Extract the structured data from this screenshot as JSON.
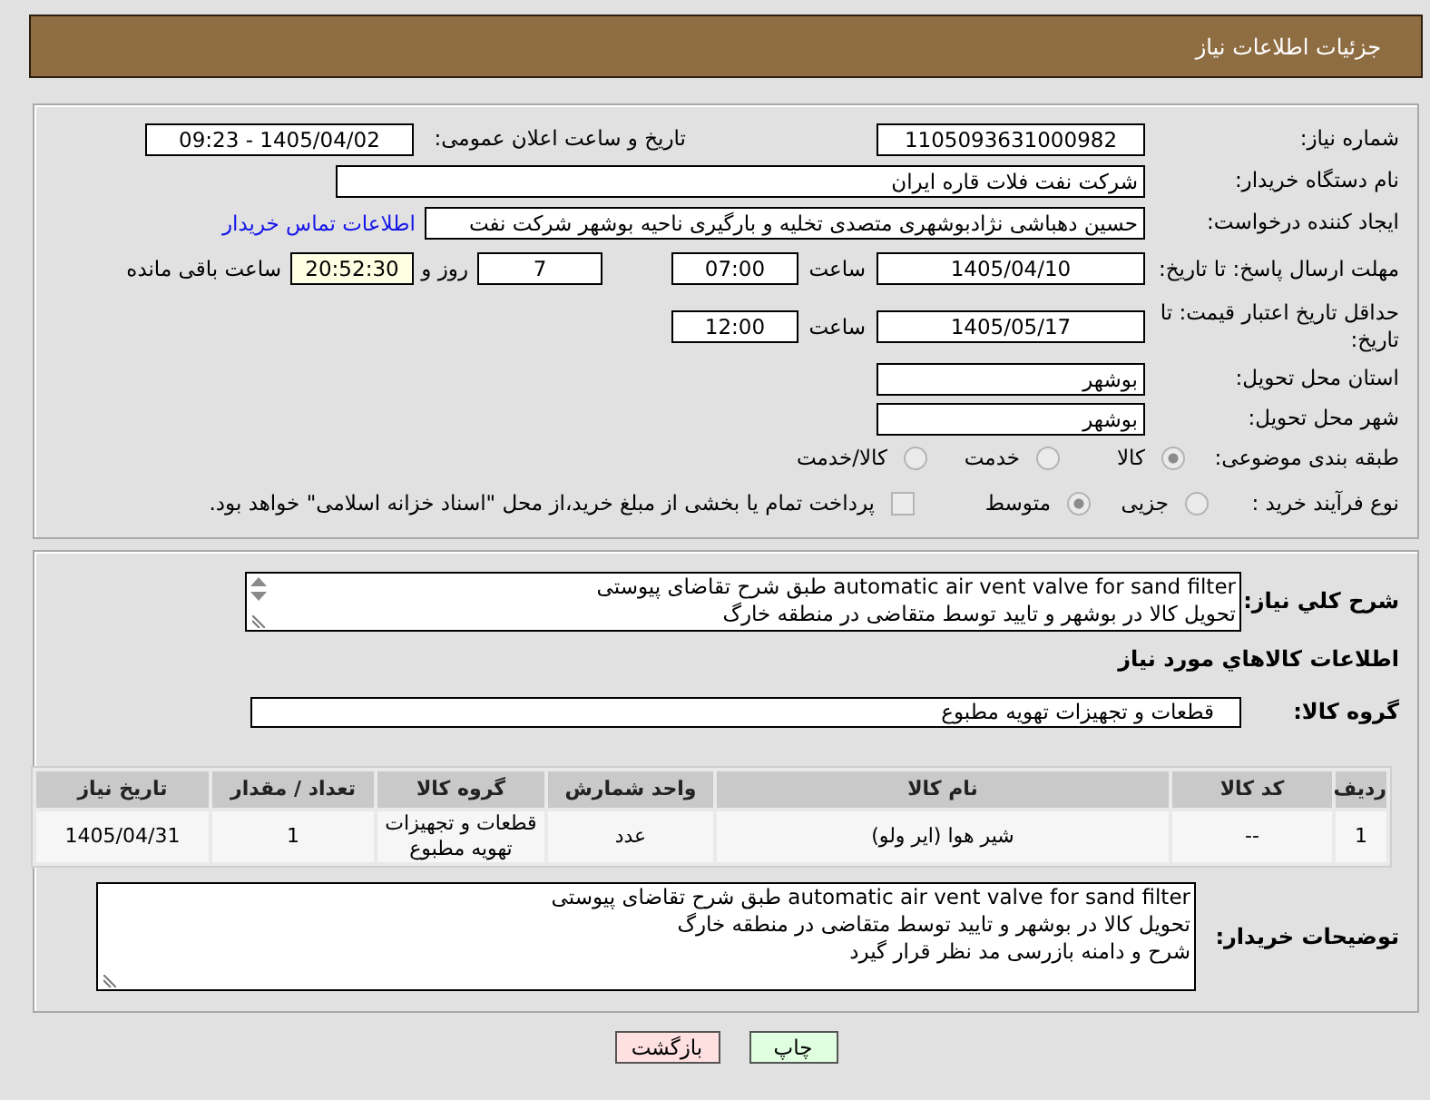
{
  "header": {
    "title": "جزئیات اطلاعات نیاز"
  },
  "need_number": {
    "label": "شماره نیاز:",
    "value": "1105093631000982"
  },
  "announcement": {
    "label": "تاریخ و ساعت اعلان عمومی:",
    "value": "1405/04/02 - 09:23"
  },
  "buyer_org": {
    "label": "نام دستگاه خریدار:",
    "value": "شرکت نفت فلات قاره ایران"
  },
  "requester": {
    "label": "ایجاد کننده درخواست:",
    "value": "حسین دهباشی نژادبوشهری متصدی تخلیه و بارگیری ناحیه بوشهر شرکت نفت",
    "contact_link": "اطلاعات تماس خریدار"
  },
  "response_deadline": {
    "label": "مهلت ارسال پاسخ: تا تاریخ:",
    "date": "1405/04/10",
    "time_label": "ساعت",
    "time": "07:00",
    "days": "7",
    "days_label": "روز و",
    "remaining": "20:52:30",
    "remaining_label": "ساعت باقی مانده"
  },
  "price_validity": {
    "label": "حداقل تاریخ اعتبار قیمت: تا تاریخ:",
    "date": "1405/05/17",
    "time_label": "ساعت",
    "time": "12:00"
  },
  "delivery_province": {
    "label": "استان محل تحویل:",
    "value": "بوشهر"
  },
  "delivery_city": {
    "label": "شهر محل تحویل:",
    "value": "بوشهر"
  },
  "category": {
    "label": "طبقه بندی موضوعی:",
    "options": [
      {
        "label": "کالا",
        "selected": true,
        "disabled": true
      },
      {
        "label": "خدمت",
        "selected": false,
        "disabled": true
      },
      {
        "label": "کالا/خدمت",
        "selected": false,
        "disabled": true
      }
    ]
  },
  "purchase_process": {
    "label": "نوع فرآیند خرید :",
    "options": [
      {
        "label": "جزیی",
        "selected": false,
        "disabled": true
      },
      {
        "label": "متوسط",
        "selected": true,
        "disabled": true
      }
    ],
    "treasury_payment": {
      "label": "پرداخت تمام یا بخشی از مبلغ خرید،از محل \"اسناد خزانه اسلامی\" خواهد بود.",
      "checked": false,
      "disabled": true
    }
  },
  "general_description": {
    "label": "شرح کلي نياز:",
    "lines": [
      "automatic air vent valve for sand filter طبق شرح تقاضای پیوستی",
      "تحویل کالا در بوشهر و تایید توسط متقاضی در منطقه خارگ"
    ]
  },
  "goods_section": {
    "title": "اطلاعات کالاهاي مورد نياز"
  },
  "goods_group": {
    "label": "گروه کالا:",
    "value": "قطعات و تجهیزات تهویه مطبوع"
  },
  "table": {
    "columns": [
      "ردیف",
      "کد کالا",
      "نام کالا",
      "واحد شمارش",
      "گروه کالا",
      "تعداد / مقدار",
      "تاریخ نیاز"
    ],
    "rows": [
      [
        "1",
        "--",
        "شیر هوا (ایر ولو)",
        "عدد",
        "قطعات و تجهیزات تهویه مطبوع",
        "1",
        "1405/04/31"
      ]
    ]
  },
  "buyer_notes": {
    "label": "توضیحات خریدار:",
    "lines": [
      "automatic air vent valve for sand filter طبق شرح تقاضای پیوستی",
      "تحویل کالا در بوشهر و تایید توسط متقاضی در منطقه خارگ",
      "شرح و دامنه بازرسی مد نظر قرار گیرد"
    ]
  },
  "buttons": [
    {
      "label": "چاپ",
      "kind": "print"
    },
    {
      "label": "بازگشت",
      "kind": "back"
    }
  ]
}
